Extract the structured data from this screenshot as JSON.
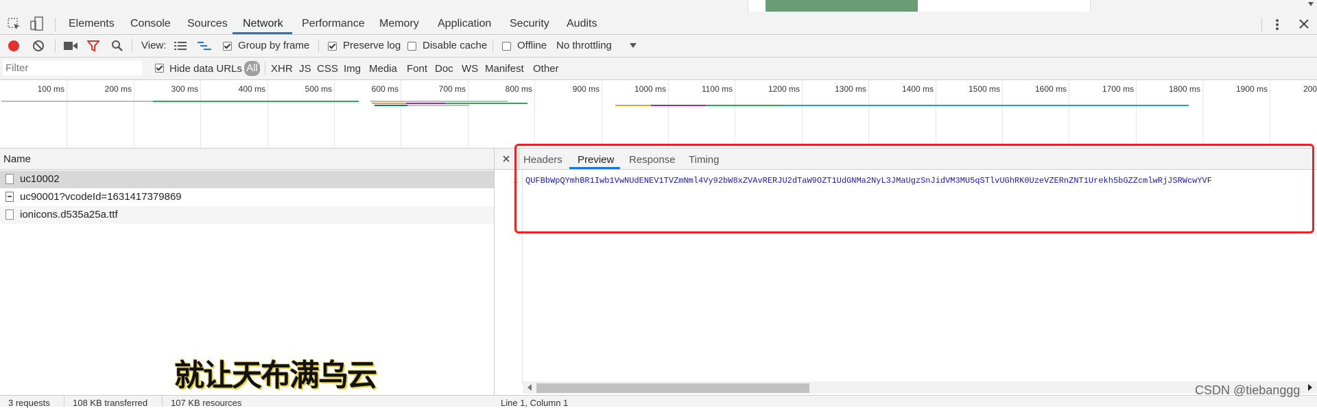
{
  "devtools_tabs": [
    "Elements",
    "Console",
    "Sources",
    "Network",
    "Performance",
    "Memory",
    "Application",
    "Security",
    "Audits"
  ],
  "active_tab": "Network",
  "toolbar": {
    "view_label": "View:",
    "group_by_frame": "Group by frame",
    "preserve_log": "Preserve log",
    "disable_cache": "Disable cache",
    "offline": "Offline",
    "throttling": "No throttling"
  },
  "filter": {
    "placeholder": "Filter",
    "hide_data_urls": "Hide data URLs",
    "types": [
      "All",
      "XHR",
      "JS",
      "CSS",
      "Img",
      "Media",
      "Font",
      "Doc",
      "WS",
      "Manifest",
      "Other"
    ]
  },
  "timeline_ticks": [
    "100 ms",
    "200 ms",
    "300 ms",
    "400 ms",
    "500 ms",
    "600 ms",
    "700 ms",
    "800 ms",
    "900 ms",
    "1000 ms",
    "1100 ms",
    "1200 ms",
    "1300 ms",
    "1400 ms",
    "1500 ms",
    "1600 ms",
    "1700 ms",
    "1800 ms",
    "1900 ms",
    "200"
  ],
  "timeline_colors": {
    "green": "#22b04b",
    "orange": "#e8a33a",
    "purple": "#9c27b0",
    "blue": "#1e9be9",
    "teal": "#0a7d6b",
    "gray": "#bbbbbb"
  },
  "requests": {
    "header": "Name",
    "rows": [
      "uc10002",
      "uc90001?vcodeId=1631417379869",
      "ionicons.d535a25a.ttf"
    ]
  },
  "details": {
    "tabs": [
      "Headers",
      "Preview",
      "Response",
      "Timing"
    ],
    "active": "Preview",
    "line_number": "1",
    "content": "QUFBbWpQYmhBR1Iwb1VwNUdENEV1TVZmNml4Vy92bW8xZVAvRERJU2dTaW9OZT1UdGNMa2NyL3JMaUgzSnJidVM3MU5qSTlvUGhRK0UzeVZERnZNT1Urekh5bGZZcmlwRjJSRWcwYVF"
  },
  "status": {
    "requests": "3 requests",
    "transferred": "108 KB transferred",
    "resources": "107 KB resources",
    "position": "Line 1, Column 1"
  },
  "overlay_caption": "就让天布满乌云",
  "watermark": "CSDN @tiebanggg"
}
